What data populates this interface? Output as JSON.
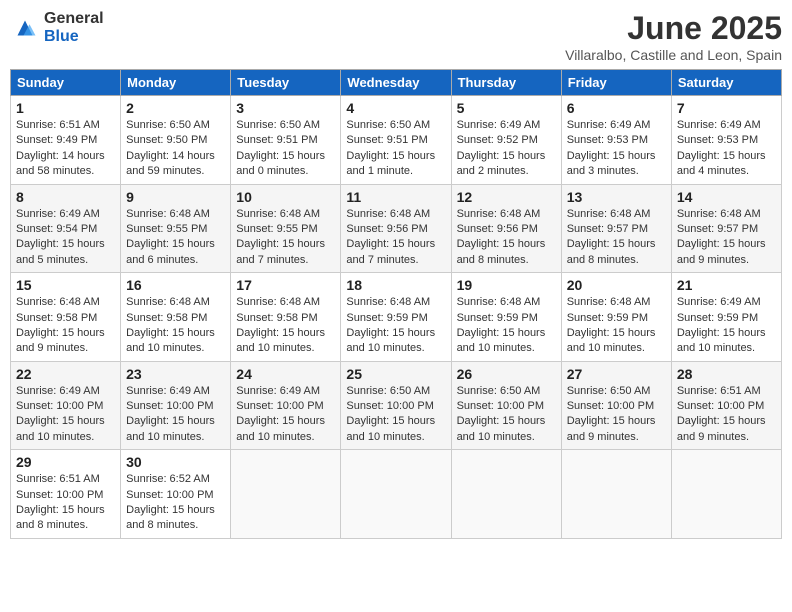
{
  "header": {
    "logo_general": "General",
    "logo_blue": "Blue",
    "month_title": "June 2025",
    "subtitle": "Villaralbo, Castille and Leon, Spain"
  },
  "weekdays": [
    "Sunday",
    "Monday",
    "Tuesday",
    "Wednesday",
    "Thursday",
    "Friday",
    "Saturday"
  ],
  "weeks": [
    [
      {
        "day": "1",
        "sunrise": "6:51 AM",
        "sunset": "9:49 PM",
        "daylight": "14 hours and 58 minutes."
      },
      {
        "day": "2",
        "sunrise": "6:50 AM",
        "sunset": "9:50 PM",
        "daylight": "14 hours and 59 minutes."
      },
      {
        "day": "3",
        "sunrise": "6:50 AM",
        "sunset": "9:51 PM",
        "daylight": "15 hours and 0 minutes."
      },
      {
        "day": "4",
        "sunrise": "6:50 AM",
        "sunset": "9:51 PM",
        "daylight": "15 hours and 1 minute."
      },
      {
        "day": "5",
        "sunrise": "6:49 AM",
        "sunset": "9:52 PM",
        "daylight": "15 hours and 2 minutes."
      },
      {
        "day": "6",
        "sunrise": "6:49 AM",
        "sunset": "9:53 PM",
        "daylight": "15 hours and 3 minutes."
      },
      {
        "day": "7",
        "sunrise": "6:49 AM",
        "sunset": "9:53 PM",
        "daylight": "15 hours and 4 minutes."
      }
    ],
    [
      {
        "day": "8",
        "sunrise": "6:49 AM",
        "sunset": "9:54 PM",
        "daylight": "15 hours and 5 minutes."
      },
      {
        "day": "9",
        "sunrise": "6:48 AM",
        "sunset": "9:55 PM",
        "daylight": "15 hours and 6 minutes."
      },
      {
        "day": "10",
        "sunrise": "6:48 AM",
        "sunset": "9:55 PM",
        "daylight": "15 hours and 7 minutes."
      },
      {
        "day": "11",
        "sunrise": "6:48 AM",
        "sunset": "9:56 PM",
        "daylight": "15 hours and 7 minutes."
      },
      {
        "day": "12",
        "sunrise": "6:48 AM",
        "sunset": "9:56 PM",
        "daylight": "15 hours and 8 minutes."
      },
      {
        "day": "13",
        "sunrise": "6:48 AM",
        "sunset": "9:57 PM",
        "daylight": "15 hours and 8 minutes."
      },
      {
        "day": "14",
        "sunrise": "6:48 AM",
        "sunset": "9:57 PM",
        "daylight": "15 hours and 9 minutes."
      }
    ],
    [
      {
        "day": "15",
        "sunrise": "6:48 AM",
        "sunset": "9:58 PM",
        "daylight": "15 hours and 9 minutes."
      },
      {
        "day": "16",
        "sunrise": "6:48 AM",
        "sunset": "9:58 PM",
        "daylight": "15 hours and 10 minutes."
      },
      {
        "day": "17",
        "sunrise": "6:48 AM",
        "sunset": "9:58 PM",
        "daylight": "15 hours and 10 minutes."
      },
      {
        "day": "18",
        "sunrise": "6:48 AM",
        "sunset": "9:59 PM",
        "daylight": "15 hours and 10 minutes."
      },
      {
        "day": "19",
        "sunrise": "6:48 AM",
        "sunset": "9:59 PM",
        "daylight": "15 hours and 10 minutes."
      },
      {
        "day": "20",
        "sunrise": "6:48 AM",
        "sunset": "9:59 PM",
        "daylight": "15 hours and 10 minutes."
      },
      {
        "day": "21",
        "sunrise": "6:49 AM",
        "sunset": "9:59 PM",
        "daylight": "15 hours and 10 minutes."
      }
    ],
    [
      {
        "day": "22",
        "sunrise": "6:49 AM",
        "sunset": "10:00 PM",
        "daylight": "15 hours and 10 minutes."
      },
      {
        "day": "23",
        "sunrise": "6:49 AM",
        "sunset": "10:00 PM",
        "daylight": "15 hours and 10 minutes."
      },
      {
        "day": "24",
        "sunrise": "6:49 AM",
        "sunset": "10:00 PM",
        "daylight": "15 hours and 10 minutes."
      },
      {
        "day": "25",
        "sunrise": "6:50 AM",
        "sunset": "10:00 PM",
        "daylight": "15 hours and 10 minutes."
      },
      {
        "day": "26",
        "sunrise": "6:50 AM",
        "sunset": "10:00 PM",
        "daylight": "15 hours and 10 minutes."
      },
      {
        "day": "27",
        "sunrise": "6:50 AM",
        "sunset": "10:00 PM",
        "daylight": "15 hours and 9 minutes."
      },
      {
        "day": "28",
        "sunrise": "6:51 AM",
        "sunset": "10:00 PM",
        "daylight": "15 hours and 9 minutes."
      }
    ],
    [
      {
        "day": "29",
        "sunrise": "6:51 AM",
        "sunset": "10:00 PM",
        "daylight": "15 hours and 8 minutes."
      },
      {
        "day": "30",
        "sunrise": "6:52 AM",
        "sunset": "10:00 PM",
        "daylight": "15 hours and 8 minutes."
      },
      null,
      null,
      null,
      null,
      null
    ]
  ]
}
